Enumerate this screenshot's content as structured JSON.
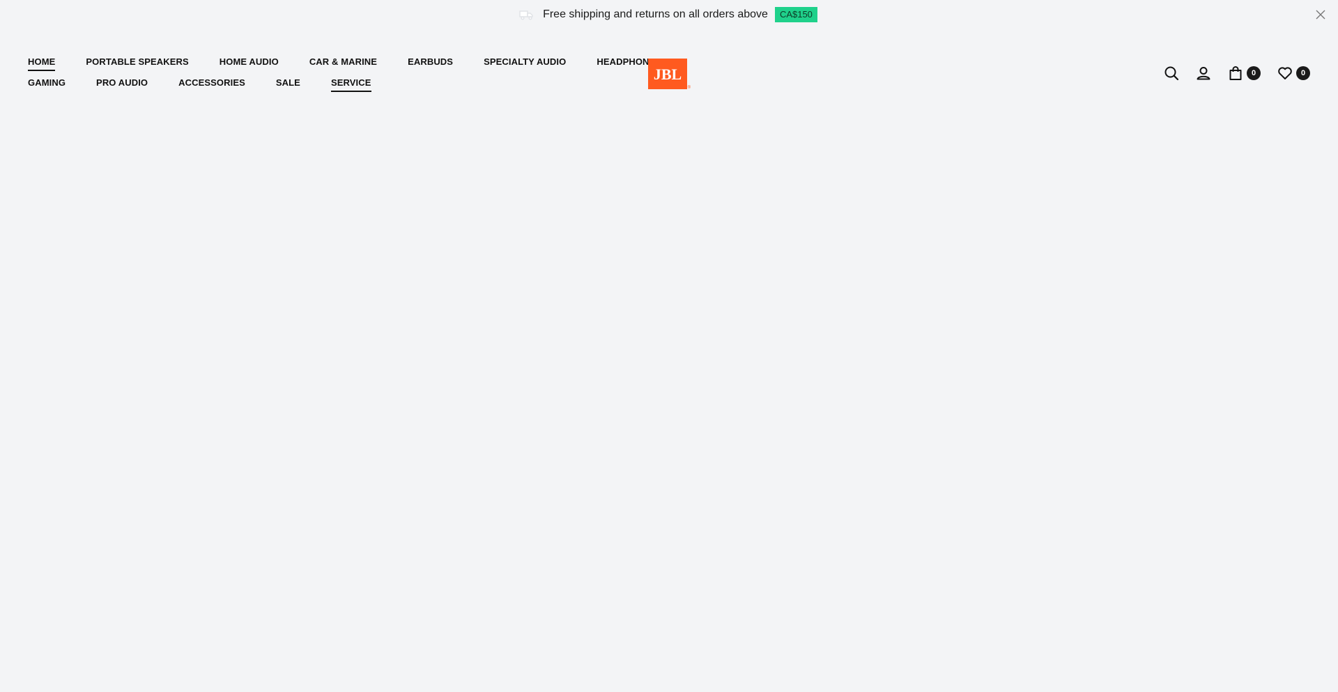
{
  "announcement": {
    "text": "Free shipping and returns on all orders above",
    "amount": "CA$150",
    "truck_icon": "truck-icon",
    "close_icon": "close-icon",
    "badge_color": "#1fd18b"
  },
  "nav": {
    "row1": [
      {
        "label": "HOME",
        "active": true
      },
      {
        "label": "PORTABLE SPEAKERS",
        "active": false
      },
      {
        "label": "HOME AUDIO",
        "active": false
      },
      {
        "label": "CAR & MARINE",
        "active": false
      },
      {
        "label": "EARBUDS",
        "active": false
      },
      {
        "label": "SPECIALTY AUDIO",
        "active": false
      },
      {
        "label": "HEADPHONES",
        "active": false
      }
    ],
    "row2": [
      {
        "label": "GAMING",
        "active": false
      },
      {
        "label": "PRO AUDIO",
        "active": false
      },
      {
        "label": "ACCESSORIES",
        "active": false
      },
      {
        "label": "SALE",
        "active": false
      },
      {
        "label": "SERVICE",
        "active": true
      }
    ]
  },
  "logo": {
    "text": "JBL",
    "reg": "®",
    "color": "#ff5a1f"
  },
  "tools": {
    "search_icon": "search-icon",
    "account_icon": "account-icon",
    "cart_icon": "cart-icon",
    "cart_count": "0",
    "wishlist_icon": "heart-icon",
    "wishlist_count": "0"
  }
}
